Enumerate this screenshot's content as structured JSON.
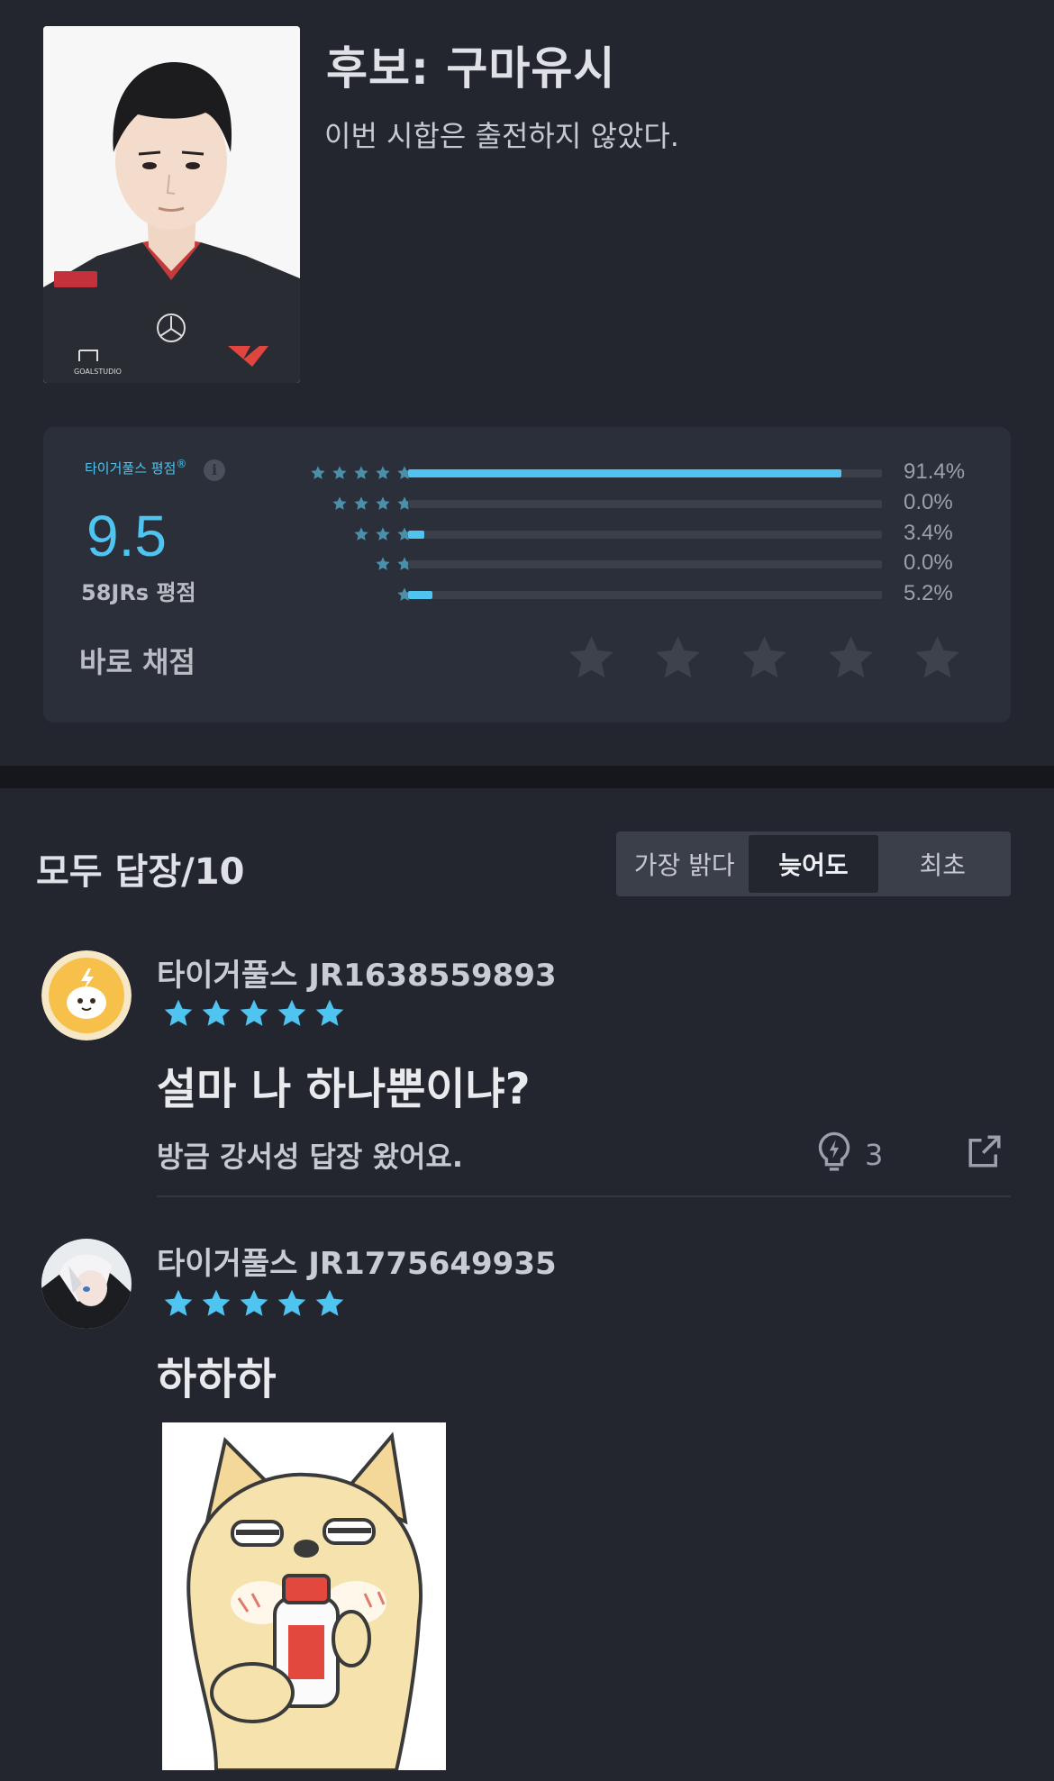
{
  "player": {
    "name": "후보: 구마유시",
    "status": "이번 시합은 출전하지 않았다.",
    "photo_watermark": "GOALSTUDIO"
  },
  "rating": {
    "label": "타이거풀스 평점",
    "registered": "®",
    "info_icon": "i",
    "score": "9.5",
    "count": "58JRs 평점",
    "rate_now": "바로 채점",
    "distribution": [
      {
        "stars": 5,
        "percent": "91.4%",
        "fill": 0.914
      },
      {
        "stars": 4,
        "percent": "0.0%",
        "fill": 0.0
      },
      {
        "stars": 3,
        "percent": "3.4%",
        "fill": 0.034
      },
      {
        "stars": 2,
        "percent": "0.0%",
        "fill": 0.0
      },
      {
        "stars": 1,
        "percent": "5.2%",
        "fill": 0.052
      }
    ],
    "accent_color": "#4fc4f0"
  },
  "replies": {
    "title": "모두 답장/10",
    "sort_tabs": [
      {
        "label": "가장 밝다",
        "active": false
      },
      {
        "label": "늦어도",
        "active": true
      },
      {
        "label": "최초",
        "active": false
      }
    ],
    "items": [
      {
        "author": "타이거풀스 JR1638559893",
        "rating_stars": 5,
        "text": "설마 나 하나뿐이냐?",
        "sub_text": "방금 강서성 답장 왔어요.",
        "likes": "3",
        "avatar_icon": "lightning-mascot-avatar"
      },
      {
        "author": "타이거풀스 JR1775649935",
        "rating_stars": 5,
        "text": "하하하",
        "avatar_icon": "anime-avatar",
        "sticker": "shiba-dog-drinking-sticker"
      }
    ]
  }
}
